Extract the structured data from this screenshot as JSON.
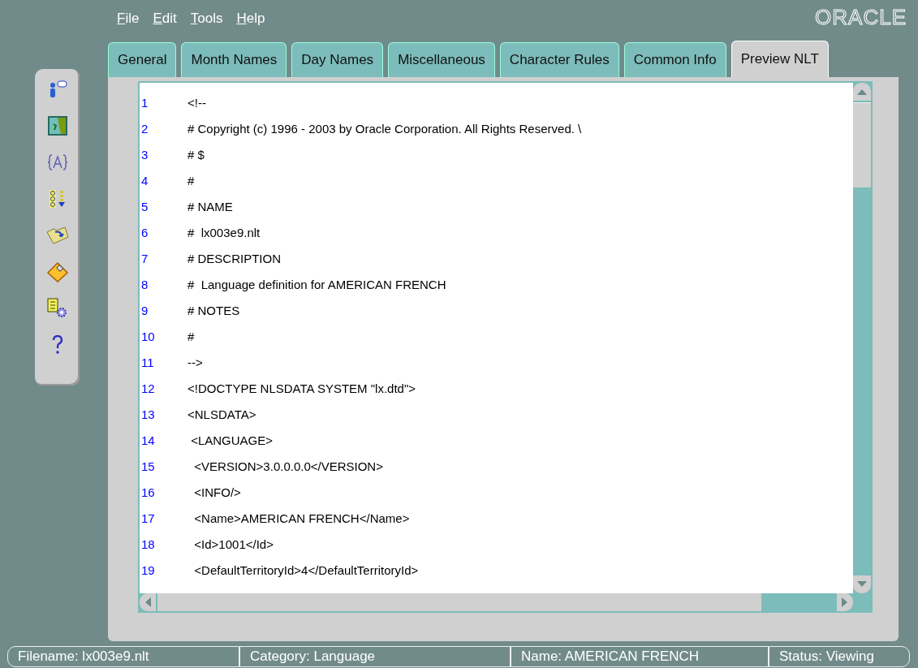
{
  "menu": [
    {
      "label": "File"
    },
    {
      "label": "Edit"
    },
    {
      "label": "Tools"
    },
    {
      "label": "Help"
    }
  ],
  "logo": "ORACLE",
  "toolbar": [
    {
      "kind": "user"
    },
    {
      "kind": "map"
    },
    {
      "kind": "braces"
    },
    {
      "kind": "sort"
    },
    {
      "kind": "open"
    },
    {
      "kind": "save"
    },
    {
      "kind": "settings"
    },
    {
      "kind": "help"
    }
  ],
  "tabs": [
    {
      "label": "General",
      "selected": false
    },
    {
      "label": "Month Names",
      "selected": false
    },
    {
      "label": "Day Names",
      "selected": false
    },
    {
      "label": "Miscellaneous",
      "selected": false
    },
    {
      "label": "Character Rules",
      "selected": false
    },
    {
      "label": "Common Info",
      "selected": false
    },
    {
      "label": "Preview NLT",
      "selected": true
    }
  ],
  "editor": {
    "lines": [
      {
        "number": "1",
        "text": "<!--"
      },
      {
        "number": "2",
        "text": "# Copyright (c) 1996 - 2003 by Oracle Corporation. All Rights Reserved. \\"
      },
      {
        "number": "3",
        "text": "# $"
      },
      {
        "number": "4",
        "text": "#"
      },
      {
        "number": "5",
        "text": "# NAME"
      },
      {
        "number": "6",
        "text": "#  lx003e9.nlt"
      },
      {
        "number": "7",
        "text": "# DESCRIPTION"
      },
      {
        "number": "8",
        "text": "#  Language definition for AMERICAN FRENCH"
      },
      {
        "number": "9",
        "text": "# NOTES"
      },
      {
        "number": "10",
        "text": "#"
      },
      {
        "number": "11",
        "text": "-->"
      },
      {
        "number": "12",
        "text": "<!DOCTYPE NLSDATA SYSTEM \"lx.dtd\">"
      },
      {
        "number": "13",
        "text": "<NLSDATA>"
      },
      {
        "number": "14",
        "text": " <LANGUAGE>"
      },
      {
        "number": "15",
        "text": "  <VERSION>3.0.0.0.0</VERSION>"
      },
      {
        "number": "16",
        "text": "  <INFO/>"
      },
      {
        "number": "17",
        "text": "  <Name>AMERICAN FRENCH</Name>"
      },
      {
        "number": "18",
        "text": "  <Id>1001</Id>"
      },
      {
        "number": "19",
        "text": "  <DefaultTerritoryId>4</DefaultTerritoryId>"
      }
    ]
  },
  "status_bar": [
    {
      "text": "Filename: lx003e9.nlt"
    },
    {
      "text": "Category: Language"
    },
    {
      "text": "Name: AMERICAN FRENCH"
    },
    {
      "text": "Status: Viewing"
    }
  ]
}
